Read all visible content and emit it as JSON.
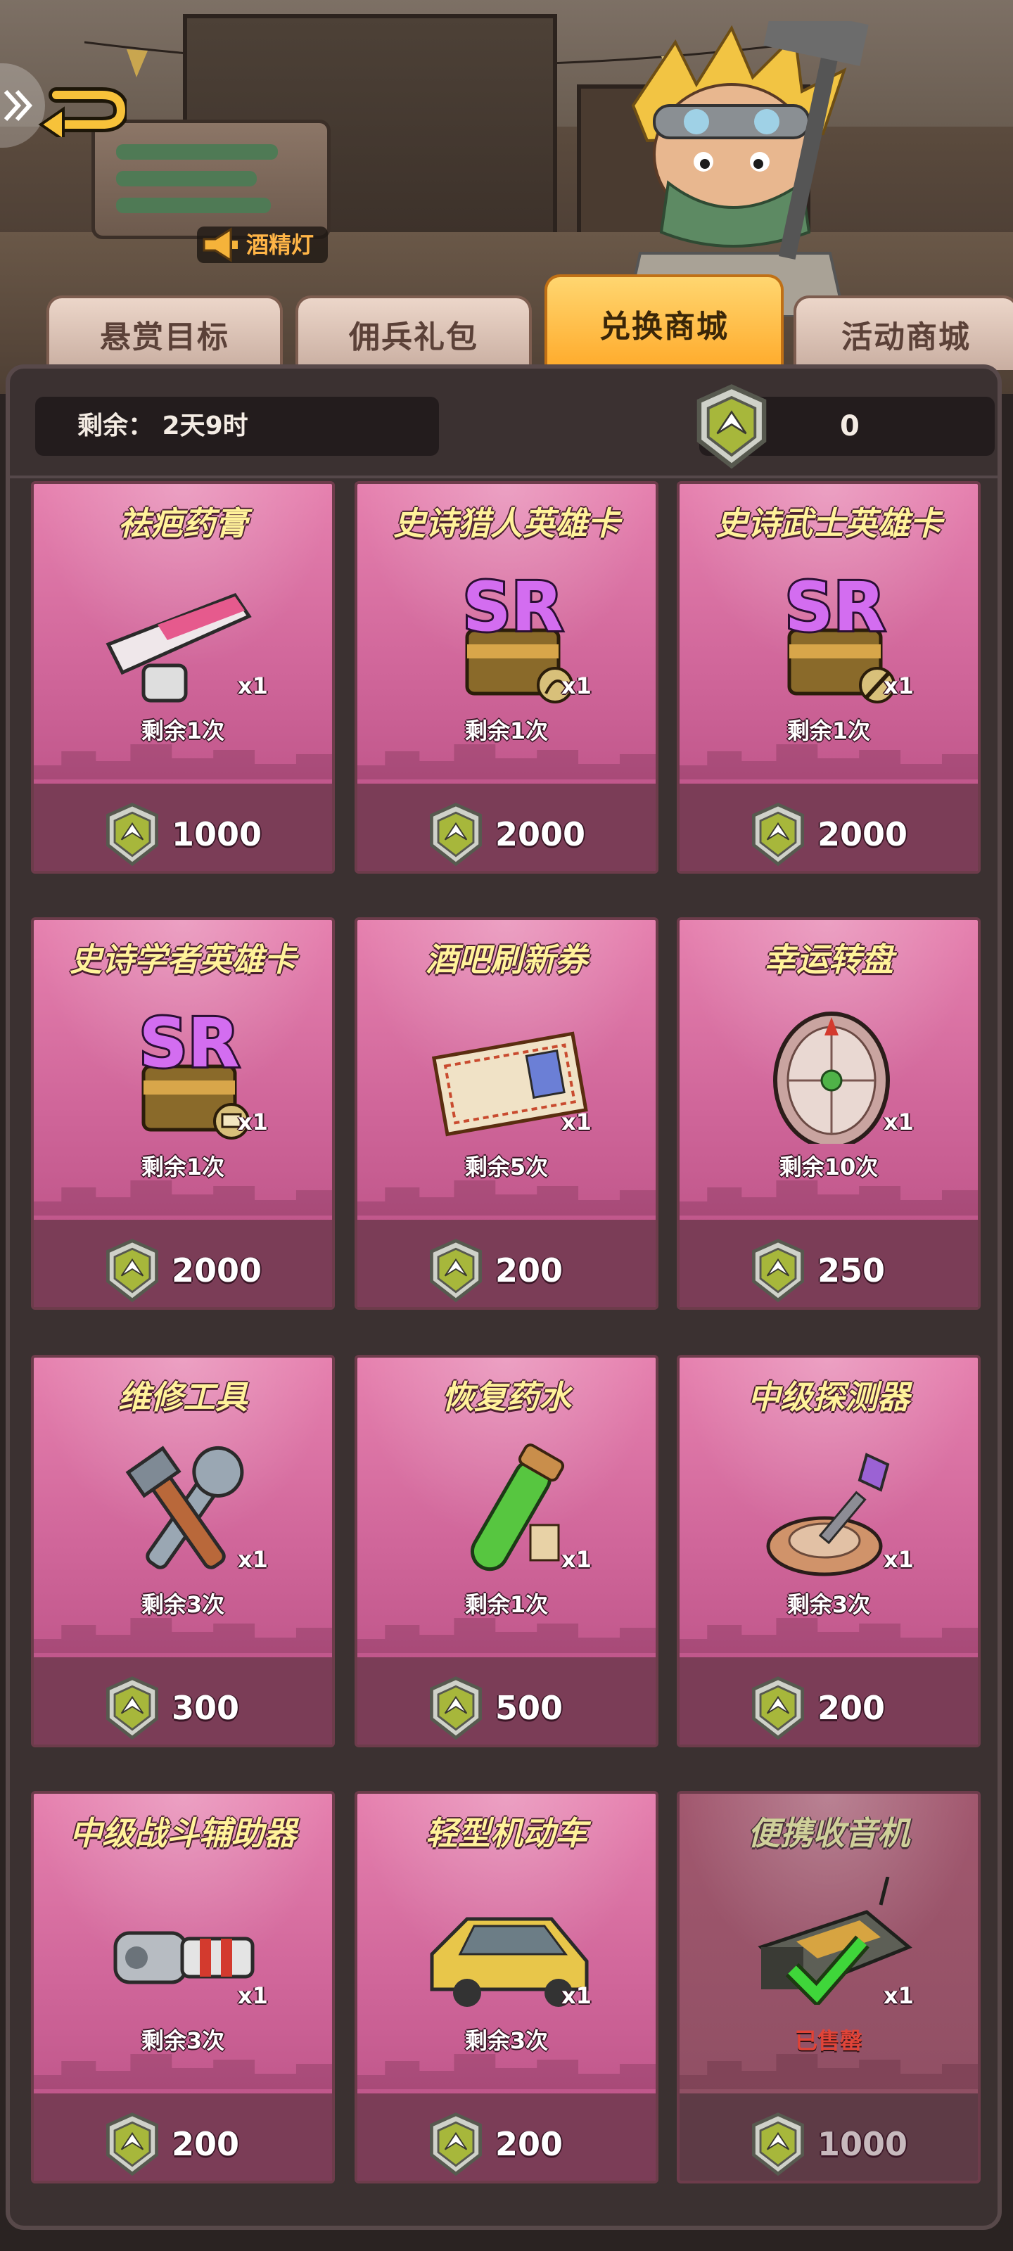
{
  "header": {
    "notice": "酒精灯",
    "back_icon": "back-arrow-icon"
  },
  "tabs": [
    {
      "label": "悬赏目标",
      "active": false
    },
    {
      "label": "佣兵礼包",
      "active": false
    },
    {
      "label": "兑换商城",
      "active": true
    },
    {
      "label": "活动商城",
      "active": false
    }
  ],
  "infobar": {
    "remaining": "剩余： 2天9时",
    "currency_amount": "0",
    "currency_icon": "badge-coin-icon"
  },
  "items": [
    {
      "title": "祛疤药膏",
      "qty": "x1",
      "left": "剩余1次",
      "price": "1000",
      "icon": "ointment-tube-icon",
      "sold": false
    },
    {
      "title": "史诗猎人英雄卡",
      "qty": "x1",
      "left": "剩余1次",
      "price": "2000",
      "icon": "sr-card-hunter-icon",
      "sold": false
    },
    {
      "title": "史诗武士英雄卡",
      "qty": "x1",
      "left": "剩余1次",
      "price": "2000",
      "icon": "sr-card-warrior-icon",
      "sold": false
    },
    {
      "title": "史诗学者英雄卡",
      "qty": "x1",
      "left": "剩余1次",
      "price": "2000",
      "icon": "sr-card-scholar-icon",
      "sold": false
    },
    {
      "title": "酒吧刷新券",
      "qty": "x1",
      "left": "剩余5次",
      "price": "200",
      "icon": "bar-ticket-icon",
      "sold": false
    },
    {
      "title": "幸运转盘",
      "qty": "x1",
      "left": "剩余10次",
      "price": "250",
      "icon": "lucky-wheel-icon",
      "sold": false
    },
    {
      "title": "维修工具",
      "qty": "x1",
      "left": "剩余3次",
      "price": "300",
      "icon": "repair-tools-icon",
      "sold": false
    },
    {
      "title": "恢复药水",
      "qty": "x1",
      "left": "剩余1次",
      "price": "500",
      "icon": "potion-tube-icon",
      "sold": false
    },
    {
      "title": "中级探测器",
      "qty": "x1",
      "left": "剩余3次",
      "price": "200",
      "icon": "detector-icon",
      "sold": false
    },
    {
      "title": "中级战斗辅助器",
      "qty": "x1",
      "left": "剩余3次",
      "price": "200",
      "icon": "combat-booster-icon",
      "sold": false
    },
    {
      "title": "轻型机动车",
      "qty": "x1",
      "left": "剩余3次",
      "price": "200",
      "icon": "light-vehicle-icon",
      "sold": false
    },
    {
      "title": "便携收音机",
      "qty": "x1",
      "left": "已售罄",
      "price": "1000",
      "icon": "portable-radio-icon",
      "sold": true
    }
  ],
  "colors": {
    "card_pink": "#d0669a",
    "price_bar": "#7b3d57",
    "title_yellow": "#fff29a",
    "tab_active": "#ffaa2a",
    "panel_bg": "#3b3131"
  }
}
